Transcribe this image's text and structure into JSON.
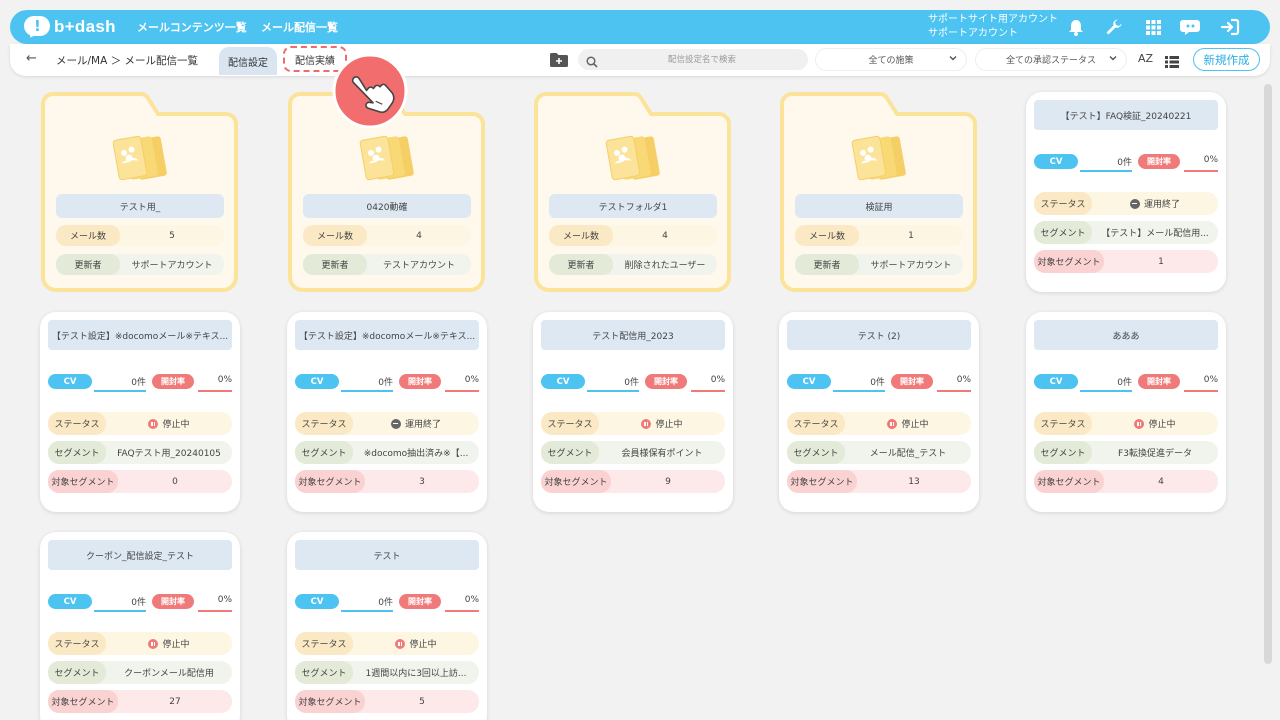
{
  "header": {
    "brand": "b+dash",
    "nav": [
      "メールコンテンツ一覧",
      "メール配信一覧"
    ],
    "account_line1": "サポートサイト用アカウント",
    "account_line2": "サポートアカウント",
    "icons": [
      "bell-icon",
      "wrench-icon",
      "grid-icon",
      "chat-bot-icon",
      "logout-icon"
    ]
  },
  "toolbar": {
    "back": "←",
    "breadcrumb": "メール/MA ＞ メール配信一覧",
    "tab_settings": "配信設定",
    "tab_results": "配信実績",
    "search_placeholder": "配信設定名で検索",
    "measure_filter": "全ての施策",
    "approval_filter": "全ての承認ステータス",
    "sort_label": "AZ",
    "new_button": "新規作成"
  },
  "labels": {
    "mail_count": "メール数",
    "updater": "更新者",
    "cv": "CV",
    "open_rate": "開封率",
    "status": "ステータス",
    "segment": "セグメント",
    "target_segment": "対象セグメント"
  },
  "folders": [
    {
      "name": "テスト用_",
      "mail_count": "5",
      "updater": "サポートアカウント"
    },
    {
      "name": "0420動確",
      "mail_count": "4",
      "updater": "テストアカウント"
    },
    {
      "name": "テストフォルダ1",
      "mail_count": "4",
      "updater": "削除されたユーザー"
    },
    {
      "name": "検証用",
      "mail_count": "1",
      "updater": "サポートアカウント"
    }
  ],
  "cards": [
    {
      "title": "【テスト】FAQ検証_20240221",
      "cv": "0件",
      "open_rate": "0%",
      "status": "運用終了",
      "status_type": "end",
      "segment": "【テスト】メール配信用...",
      "target": "1"
    },
    {
      "title": "【テスト設定】※docomoメール※テキス...",
      "cv": "0件",
      "open_rate": "0%",
      "status": "停止中",
      "status_type": "stop",
      "segment": "FAQテスト用_20240105",
      "target": "0"
    },
    {
      "title": "【テスト設定】※docomoメール※テキス...",
      "cv": "0件",
      "open_rate": "0%",
      "status": "運用終了",
      "status_type": "end",
      "segment": "※docomo抽出済み※【...",
      "target": "3"
    },
    {
      "title": "テスト配信用_2023",
      "cv": "0件",
      "open_rate": "0%",
      "status": "停止中",
      "status_type": "stop",
      "segment": "会員様保有ポイント",
      "target": "9"
    },
    {
      "title": "テスト (2)",
      "cv": "0件",
      "open_rate": "0%",
      "status": "停止中",
      "status_type": "stop",
      "segment": "メール配信_テスト",
      "target": "13"
    },
    {
      "title": "あああ",
      "cv": "0件",
      "open_rate": "0%",
      "status": "停止中",
      "status_type": "stop",
      "segment": "F3転換促進データ",
      "target": "4"
    },
    {
      "title": "クーポン_配信設定_テスト",
      "cv": "0件",
      "open_rate": "0%",
      "status": "停止中",
      "status_type": "stop",
      "segment": "クーポンメール配信用",
      "target": "27"
    },
    {
      "title": "テスト",
      "cv": "0件",
      "open_rate": "0%",
      "status": "停止中",
      "status_type": "stop",
      "segment": "1週間以内に3回以上訪...",
      "target": "5"
    }
  ],
  "colors": {
    "primary": "#4cc3f1",
    "open_rate": "#f07a7a",
    "folder": "#fbe39a",
    "highlight": "#f06a6a"
  }
}
